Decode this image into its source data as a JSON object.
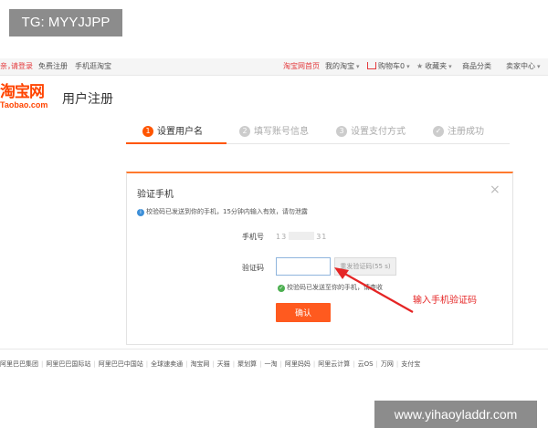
{
  "watermarks": {
    "top": "TG: MYYJJPP",
    "bottom": "www.yihaoyladdr.com"
  },
  "topnav": {
    "login_prefix": "亲，",
    "login": "请登录",
    "register": "免费注册",
    "mobile": "手机逛淘宝",
    "home": "淘宝网首页",
    "my_taobao": "我的淘宝",
    "cart": "购物车0",
    "favorites": "收藏夹",
    "categories": "商品分类",
    "seller": "卖家中心"
  },
  "header": {
    "logo_cn": "淘宝网",
    "logo_en": "Taobao.com",
    "title": "用户注册"
  },
  "steps": [
    {
      "num": "1",
      "label": "设置用户名"
    },
    {
      "num": "2",
      "label": "填写账号信息"
    },
    {
      "num": "3",
      "label": "设置支付方式"
    },
    {
      "num": "✓",
      "label": "注册成功"
    }
  ],
  "panel": {
    "title": "验证手机",
    "close": "×",
    "notice": "校验码已发送到你的手机，15分钟内输入有效，请勿泄露",
    "phone_label": "手机号",
    "phone_value": "13",
    "phone_value_end": "31",
    "code_label": "验证码",
    "code_value": "",
    "resend": "重发验证码(55 s)",
    "sent_msg": "校验码已发送至你的手机，请查收",
    "confirm": "确认"
  },
  "annotation": "输入手机验证码",
  "footer": [
    "阿里巴巴集团",
    "阿里巴巴国际站",
    "阿里巴巴中国站",
    "全球速卖通",
    "淘宝网",
    "天猫",
    "聚划算",
    "一淘",
    "阿里妈妈",
    "阿里云计算",
    "云OS",
    "万网",
    "支付宝"
  ],
  "colors": {
    "accent": "#ff5500",
    "arrow": "#e52525",
    "link": "#e4393c"
  }
}
